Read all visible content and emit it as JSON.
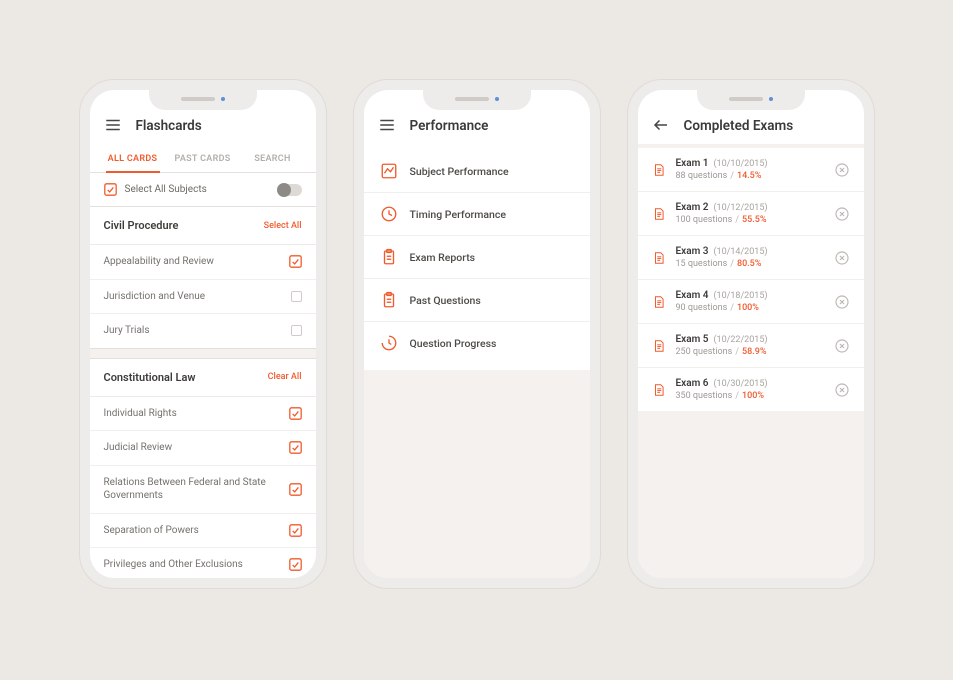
{
  "colors": {
    "accent": "#f05b2d",
    "bg": "#ece9e4",
    "muted": "#a8a39d"
  },
  "phone1": {
    "title": "Flashcards",
    "tabs": {
      "all": "ALL CARDS",
      "past": "PAST CARDS",
      "search": "SEARCH"
    },
    "select_all_subjects": "Select All Subjects",
    "sections": [
      {
        "title": "Civil Procedure",
        "action": "Select All",
        "items": [
          {
            "label": "Appealability and Review",
            "checked": true
          },
          {
            "label": "Jurisdiction and Venue",
            "checked": false
          },
          {
            "label": "Jury Trials",
            "checked": false
          }
        ]
      },
      {
        "title": "Constitutional Law",
        "action": "Clear All",
        "items": [
          {
            "label": "Individual Rights",
            "checked": true
          },
          {
            "label": "Judicial Review",
            "checked": true
          },
          {
            "label": "Relations Between Federal and State Governments",
            "checked": true
          },
          {
            "label": "Separation of Powers",
            "checked": true
          },
          {
            "label": "Privileges and Other Exclusions",
            "checked": true
          }
        ]
      }
    ]
  },
  "phone2": {
    "title": "Performance",
    "items": [
      {
        "icon": "chart",
        "label": "Subject Performance"
      },
      {
        "icon": "clock",
        "label": "Timing Performance"
      },
      {
        "icon": "clipboard",
        "label": "Exam Reports"
      },
      {
        "icon": "clipboard",
        "label": "Past Questions"
      },
      {
        "icon": "progress",
        "label": "Question Progress"
      }
    ]
  },
  "phone3": {
    "title": "Completed Exams",
    "exams": [
      {
        "name": "Exam 1",
        "date": "(10/10/2015)",
        "q": "88 questions",
        "pct": "14.5%"
      },
      {
        "name": "Exam 2",
        "date": "(10/12/2015)",
        "q": "100 questions",
        "pct": "55.5%"
      },
      {
        "name": "Exam 3",
        "date": "(10/14/2015)",
        "q": "15 questions",
        "pct": "80.5%"
      },
      {
        "name": "Exam 4",
        "date": "(10/18/2015)",
        "q": "90 questions",
        "pct": "100%"
      },
      {
        "name": "Exam 5",
        "date": "(10/22/2015)",
        "q": "250 questions",
        "pct": "58.9%"
      },
      {
        "name": "Exam 6",
        "date": "(10/30/2015)",
        "q": "350 questions",
        "pct": "100%"
      }
    ]
  }
}
